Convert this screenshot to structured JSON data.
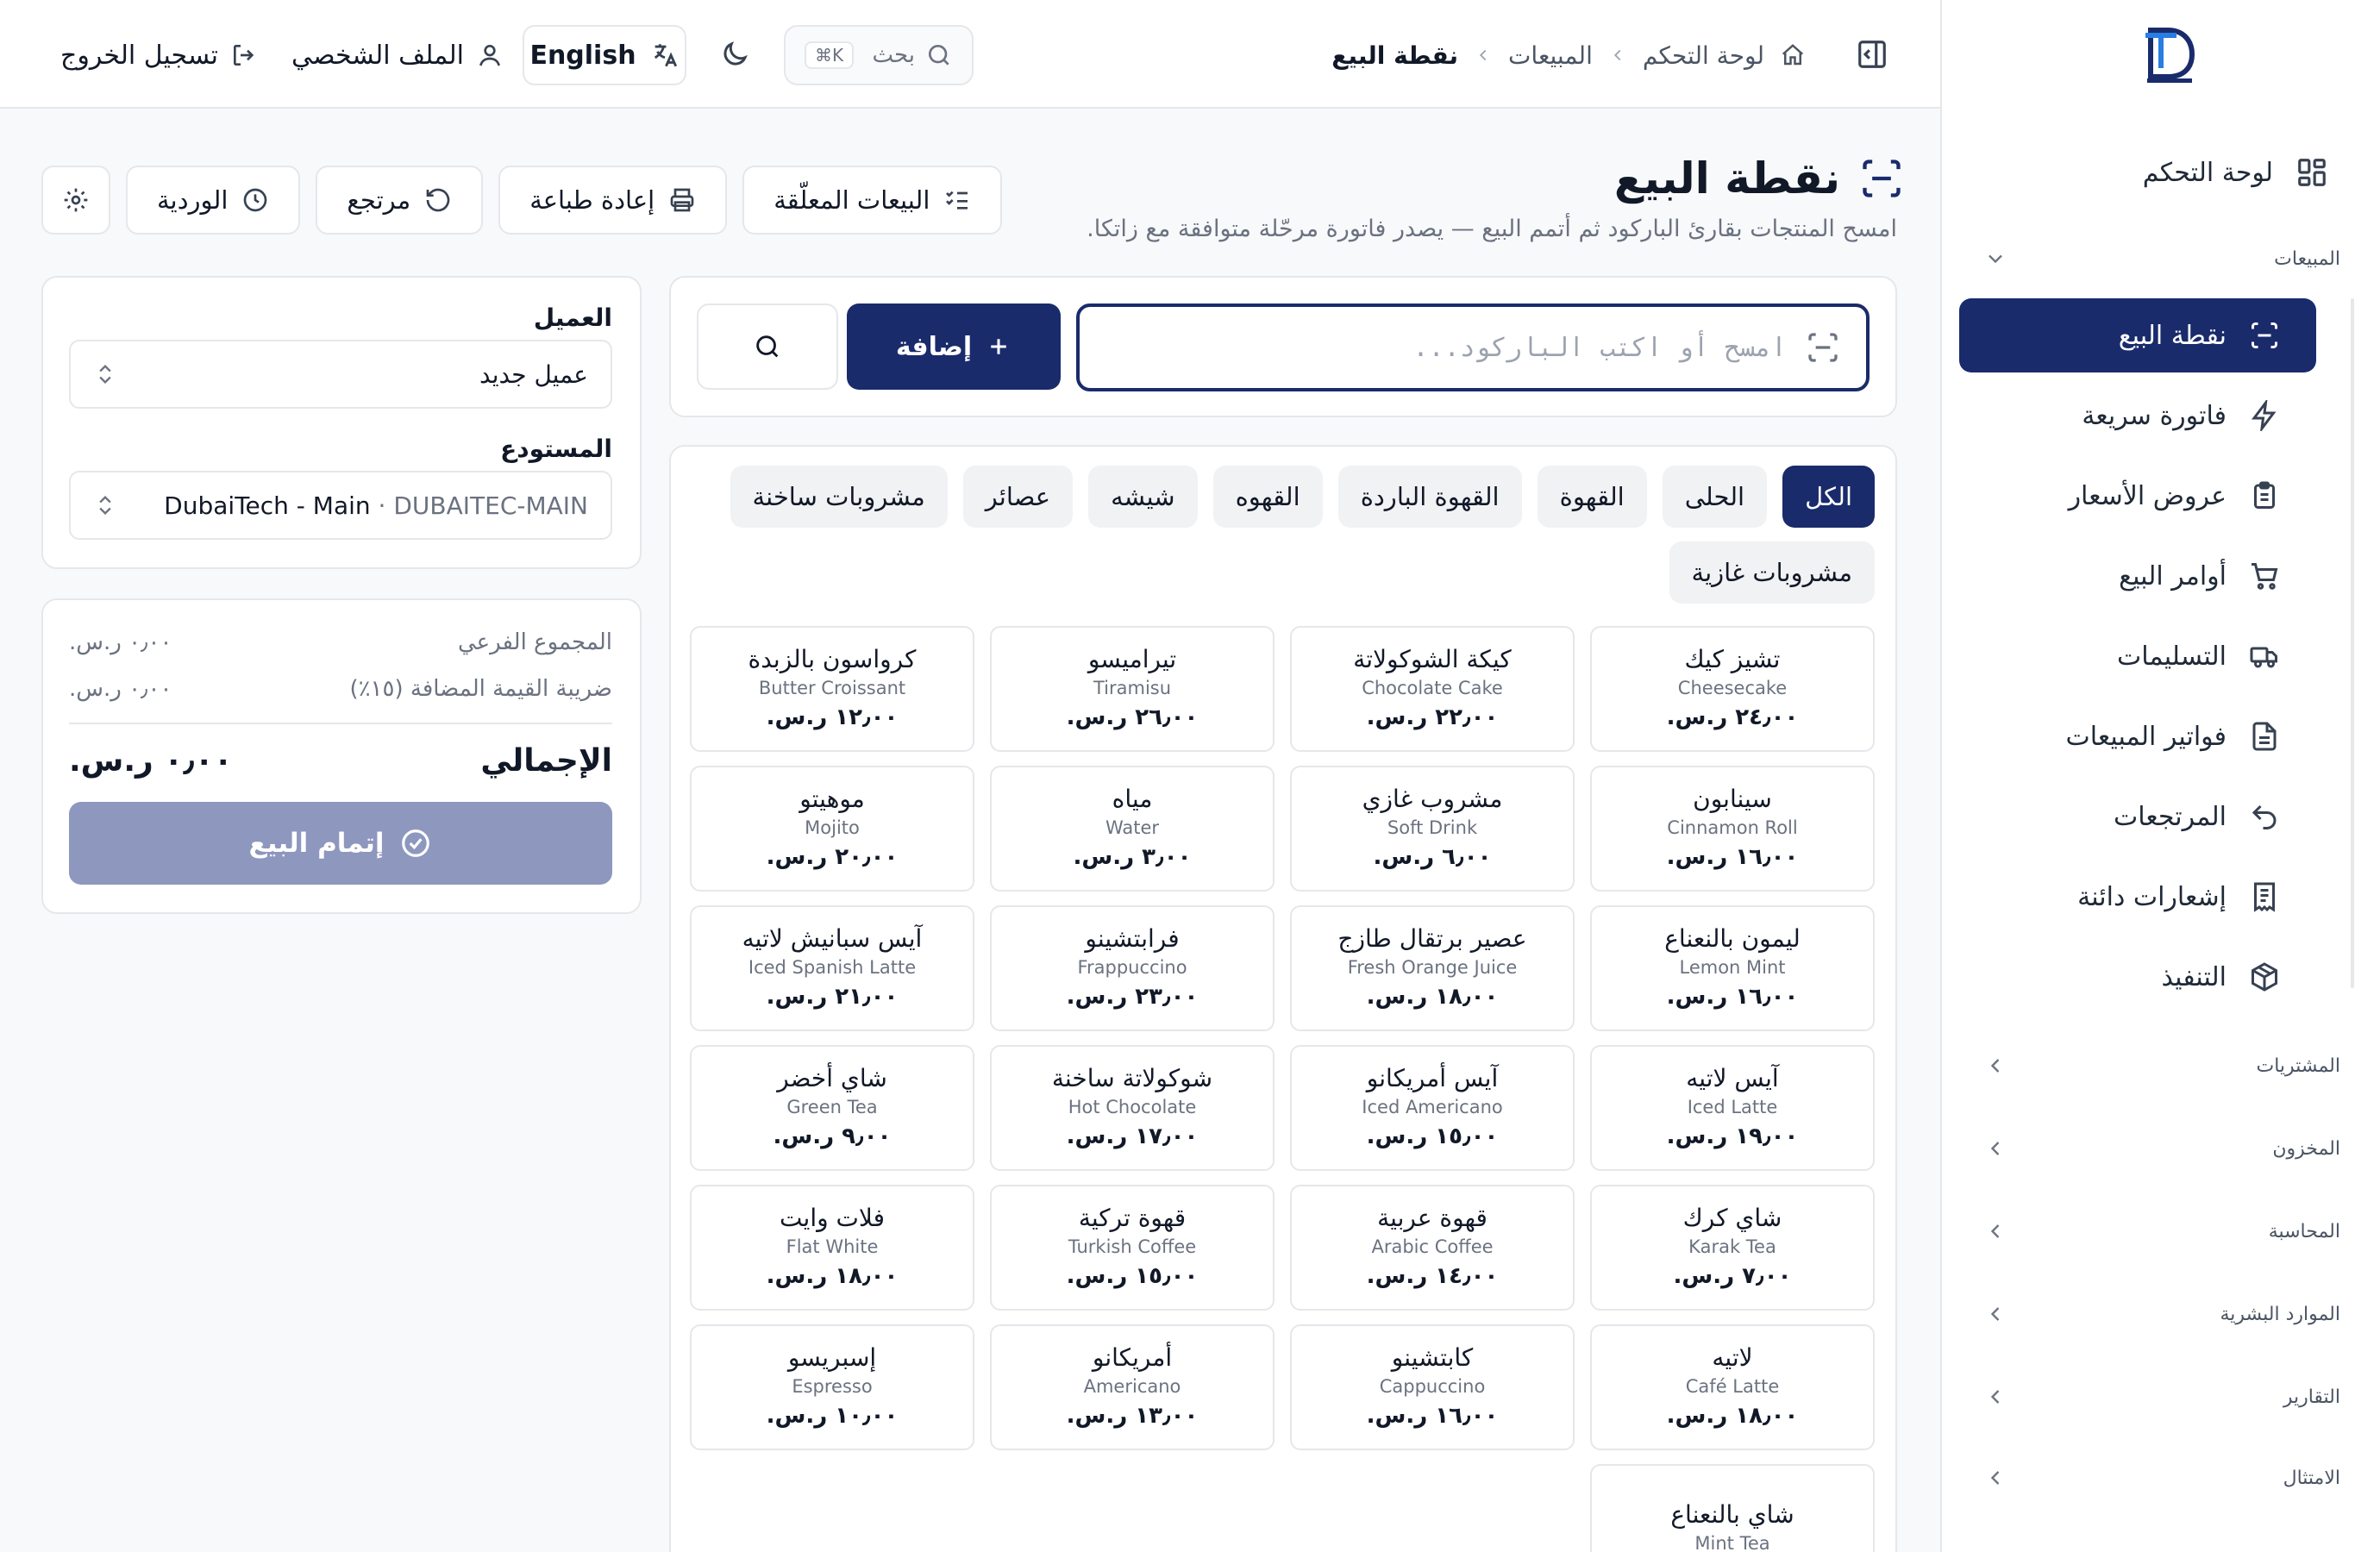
{
  "sidebar": {
    "dashboard_label": "لوحة التحكم",
    "sales_group_label": "المبيعات",
    "items": [
      {
        "label": "نقطة البيع",
        "icon": "scan-icon",
        "active": true
      },
      {
        "label": "فاتورة سريعة",
        "icon": "bolt-icon",
        "active": false
      },
      {
        "label": "عروض الأسعار",
        "icon": "clipboard-icon",
        "active": false
      },
      {
        "label": "أوامر البيع",
        "icon": "cart-icon",
        "active": false
      },
      {
        "label": "التسليمات",
        "icon": "truck-icon",
        "active": false
      },
      {
        "label": "فواتير المبيعات",
        "icon": "file-icon",
        "active": false
      },
      {
        "label": "المرتجعات",
        "icon": "undo-icon",
        "active": false
      },
      {
        "label": "إشعارات دائنة",
        "icon": "receipt-icon",
        "active": false
      },
      {
        "label": "التنفيذ",
        "icon": "package-icon",
        "active": false
      }
    ],
    "groups": [
      "المشتريات",
      "المخزون",
      "المحاسبة",
      "الموارد البشرية",
      "التقارير",
      "الامتثال"
    ]
  },
  "topbar": {
    "breadcrumb": [
      "لوحة التحكم",
      "المبيعات",
      "نقطة البيع"
    ],
    "search_placeholder": "بحث",
    "search_shortcut": "⌘K",
    "language_label": "English",
    "profile_label": "الملف الشخصي",
    "logout_label": "تسجيل الخروج"
  },
  "page": {
    "title": "نقطة البيع",
    "subtitle": "امسح المنتجات بقارئ الباركود ثم أتمم البيع — يصدر فاتورة مرحّلة متوافقة مع زاتكا."
  },
  "actions": {
    "held_sales": "البيعات المعلّقة",
    "reprint": "إعادة طباعة",
    "return": "مرتجع",
    "shift": "الوردية"
  },
  "scan": {
    "placeholder": "امسح أو اكتب الباركود...",
    "add_label": "إضافة"
  },
  "categories": [
    {
      "label": "الكل",
      "active": true
    },
    {
      "label": "الحلى",
      "active": false
    },
    {
      "label": "القهوة",
      "active": false
    },
    {
      "label": "القهوة الباردة",
      "active": false
    },
    {
      "label": "القهوه",
      "active": false
    },
    {
      "label": "شيشه",
      "active": false
    },
    {
      "label": "عصائر",
      "active": false
    },
    {
      "label": "مشروبات ساخنة",
      "active": false
    },
    {
      "label": "مشروبات غازية",
      "active": false
    }
  ],
  "products": [
    {
      "ar": "تشيز كيك",
      "en": "Cheesecake",
      "price": "٢٤٫٠٠ ر.س."
    },
    {
      "ar": "كيكة الشوكولاتة",
      "en": "Chocolate Cake",
      "price": "٢٢٫٠٠ ر.س."
    },
    {
      "ar": "تيراميسو",
      "en": "Tiramisu",
      "price": "٢٦٫٠٠ ر.س."
    },
    {
      "ar": "كرواسون بالزبدة",
      "en": "Butter Croissant",
      "price": "١٢٫٠٠ ر.س."
    },
    {
      "ar": "سينابون",
      "en": "Cinnamon Roll",
      "price": "١٦٫٠٠ ر.س."
    },
    {
      "ar": "مشروب غازي",
      "en": "Soft Drink",
      "price": "٦٫٠٠ ر.س."
    },
    {
      "ar": "مياه",
      "en": "Water",
      "price": "٣٫٠٠ ر.س."
    },
    {
      "ar": "موهيتو",
      "en": "Mojito",
      "price": "٢٠٫٠٠ ر.س."
    },
    {
      "ar": "ليمون بالنعناع",
      "en": "Lemon Mint",
      "price": "١٦٫٠٠ ر.س."
    },
    {
      "ar": "عصير برتقال طازج",
      "en": "Fresh Orange Juice",
      "price": "١٨٫٠٠ ر.س."
    },
    {
      "ar": "فرابتشينو",
      "en": "Frappuccino",
      "price": "٢٣٫٠٠ ر.س."
    },
    {
      "ar": "آيس سبانيش لاتيه",
      "en": "Iced Spanish Latte",
      "price": "٢١٫٠٠ ر.س."
    },
    {
      "ar": "آيس لاتيه",
      "en": "Iced Latte",
      "price": "١٩٫٠٠ ر.س."
    },
    {
      "ar": "آيس أمريكانو",
      "en": "Iced Americano",
      "price": "١٥٫٠٠ ر.س."
    },
    {
      "ar": "شوكولاتة ساخنة",
      "en": "Hot Chocolate",
      "price": "١٧٫٠٠ ر.س."
    },
    {
      "ar": "شاي أخضر",
      "en": "Green Tea",
      "price": "٩٫٠٠ ر.س."
    },
    {
      "ar": "شاي كرك",
      "en": "Karak Tea",
      "price": "٧٫٠٠ ر.س."
    },
    {
      "ar": "قهوة عربية",
      "en": "Arabic Coffee",
      "price": "١٤٫٠٠ ر.س."
    },
    {
      "ar": "قهوة تركية",
      "en": "Turkish Coffee",
      "price": "١٥٫٠٠ ر.س."
    },
    {
      "ar": "فلات وايت",
      "en": "Flat White",
      "price": "١٨٫٠٠ ر.س."
    },
    {
      "ar": "لاتيه",
      "en": "Café Latte",
      "price": "١٨٫٠٠ ر.س."
    },
    {
      "ar": "كابتشينو",
      "en": "Cappuccino",
      "price": "١٦٫٠٠ ر.س."
    },
    {
      "ar": "أمريكانو",
      "en": "Americano",
      "price": "١٣٫٠٠ ر.س."
    },
    {
      "ar": "إسبريسو",
      "en": "Espresso",
      "price": "١٠٫٠٠ ر.س."
    },
    {
      "ar": "شاي بالنعناع",
      "en": "Mint Tea",
      "price": ""
    }
  ],
  "customer": {
    "label": "العميل",
    "value": "عميل جديد"
  },
  "warehouse": {
    "label": "المستودع",
    "name": "DubaiTech - Main",
    "separator": " · ",
    "code": "DUBAITEC-MAIN"
  },
  "totals": {
    "subtotal_label": "المجموع الفرعي",
    "subtotal_value": "٠٫٠٠ ر.س.",
    "vat_label": "ضريبة القيمة المضافة (١٥٪)",
    "vat_value": "٠٫٠٠ ر.س.",
    "total_label": "الإجمالي",
    "total_value": "٠٫٠٠ ر.س.",
    "complete_label": "إتمام البيع"
  },
  "colors": {
    "primary": "#1a2b6b",
    "disabled_primary": "#8e97be"
  }
}
